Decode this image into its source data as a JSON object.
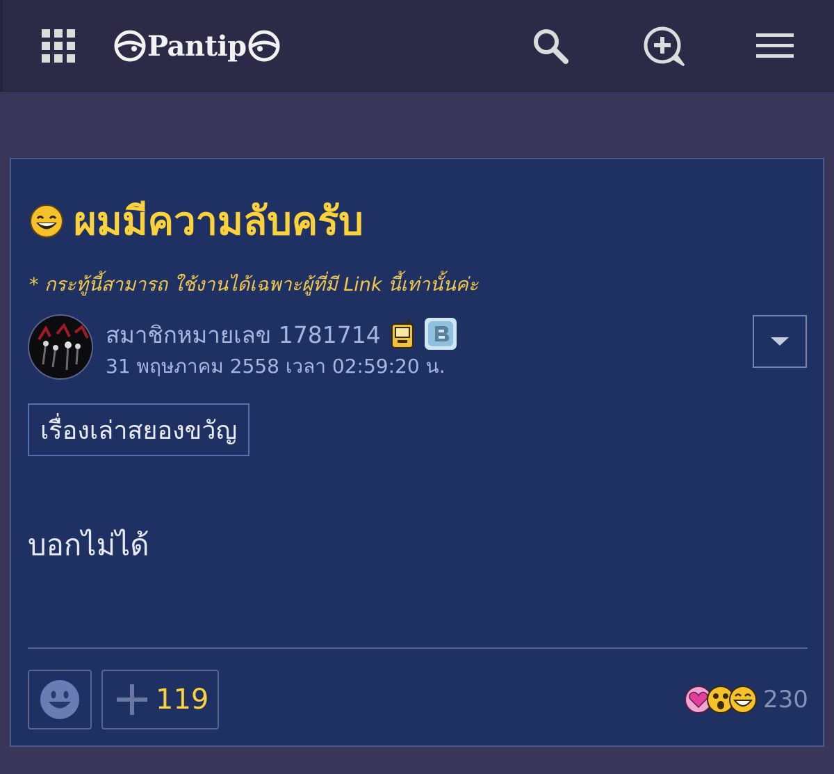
{
  "header": {
    "logo_text": "Pantip",
    "apps_icon": "apps-grid-icon",
    "search_icon": "search-icon",
    "new_topic_icon": "add-topic-icon",
    "menu_icon": "hamburger-menu-icon"
  },
  "post": {
    "title": "ผมมีความลับครับ",
    "title_icon": "grinning-face-icon",
    "notice": "* กระทู้นี้สามารถ ใช้งานได้เฉพาะผู้ที่มี Link นี้เท่านั้นค่ะ",
    "author": "สมาชิกหมายเลข 1781714",
    "timestamp": "31 พฤษภาคม 2558 เวลา 02:59:20 น.",
    "tag": "เรื่องเล่าสยองขวัญ",
    "body": "บอกไม่ได้",
    "vote_count": "119",
    "reaction_count": "230"
  },
  "colors": {
    "header_bg": "#2d2a48",
    "page_bg": "#3a3659",
    "card_bg": "#1f3162",
    "title": "#fbd23c",
    "muted_text": "#a8b5dd"
  }
}
